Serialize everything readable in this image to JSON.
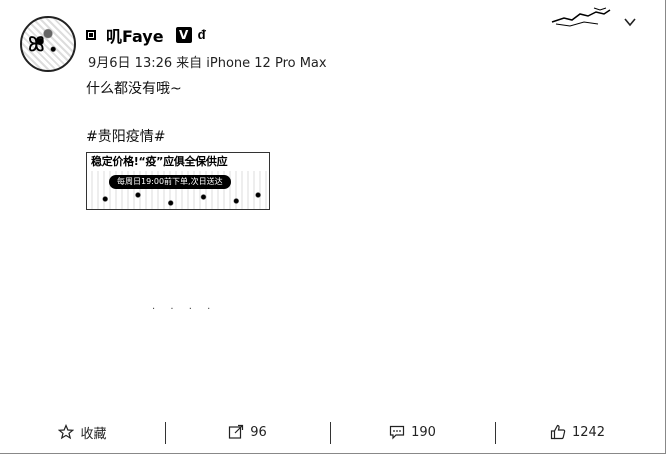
{
  "post": {
    "username": "叽Faye",
    "verified_mark": "V",
    "badge": "ᵭ",
    "timestamp": "9月6日 13:26",
    "source": "来自 iPhone 12 Pro Max",
    "text": "什么都没有哦~",
    "hashtag": "#贵阳疫情#",
    "image": {
      "banner": "稳定价格!“疫”应俱全保供应",
      "pill": "每周日19:00前下单,次日送达"
    }
  },
  "actions": {
    "favorite_label": "收藏",
    "repost_count": "96",
    "comment_count": "190",
    "like_count": "1242"
  },
  "icons": {
    "avatar": "avatar-icon",
    "menu": "chevron-down-icon",
    "favorite": "star-icon",
    "repost": "share-icon",
    "comment": "comment-icon",
    "like": "thumbs-up-icon"
  }
}
